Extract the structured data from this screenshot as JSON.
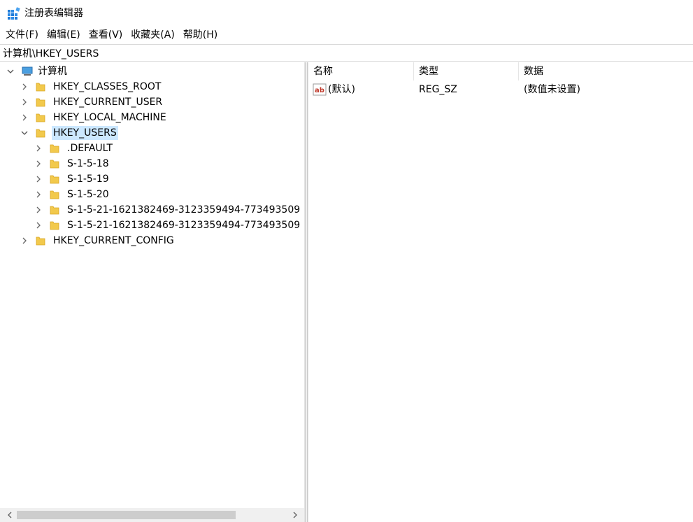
{
  "window": {
    "title": "注册表编辑器"
  },
  "menu": [
    "文件(F)",
    "编辑(E)",
    "查看(V)",
    "收藏夹(A)",
    "帮助(H)"
  ],
  "address": {
    "value": "计算机\\HKEY_USERS"
  },
  "tree": {
    "root": "计算机",
    "hives": [
      "HKEY_CLASSES_ROOT",
      "HKEY_CURRENT_USER",
      "HKEY_LOCAL_MACHINE",
      "HKEY_USERS",
      "HKEY_CURRENT_CONFIG"
    ],
    "selected_hive": "HKEY_USERS",
    "children_of_selected": [
      ".DEFAULT",
      "S-1-5-18",
      "S-1-5-19",
      "S-1-5-20",
      "S-1-5-21-1621382469-3123359494-773493509",
      "S-1-5-21-1621382469-3123359494-773493509"
    ]
  },
  "list": {
    "columns": [
      "名称",
      "类型",
      "数据"
    ],
    "rows": [
      {
        "name": "(默认)",
        "type": "REG_SZ",
        "data": "(数值未设置)"
      }
    ]
  },
  "colors": {
    "selection": "#cce8ff",
    "folder": "#f2c94c"
  }
}
